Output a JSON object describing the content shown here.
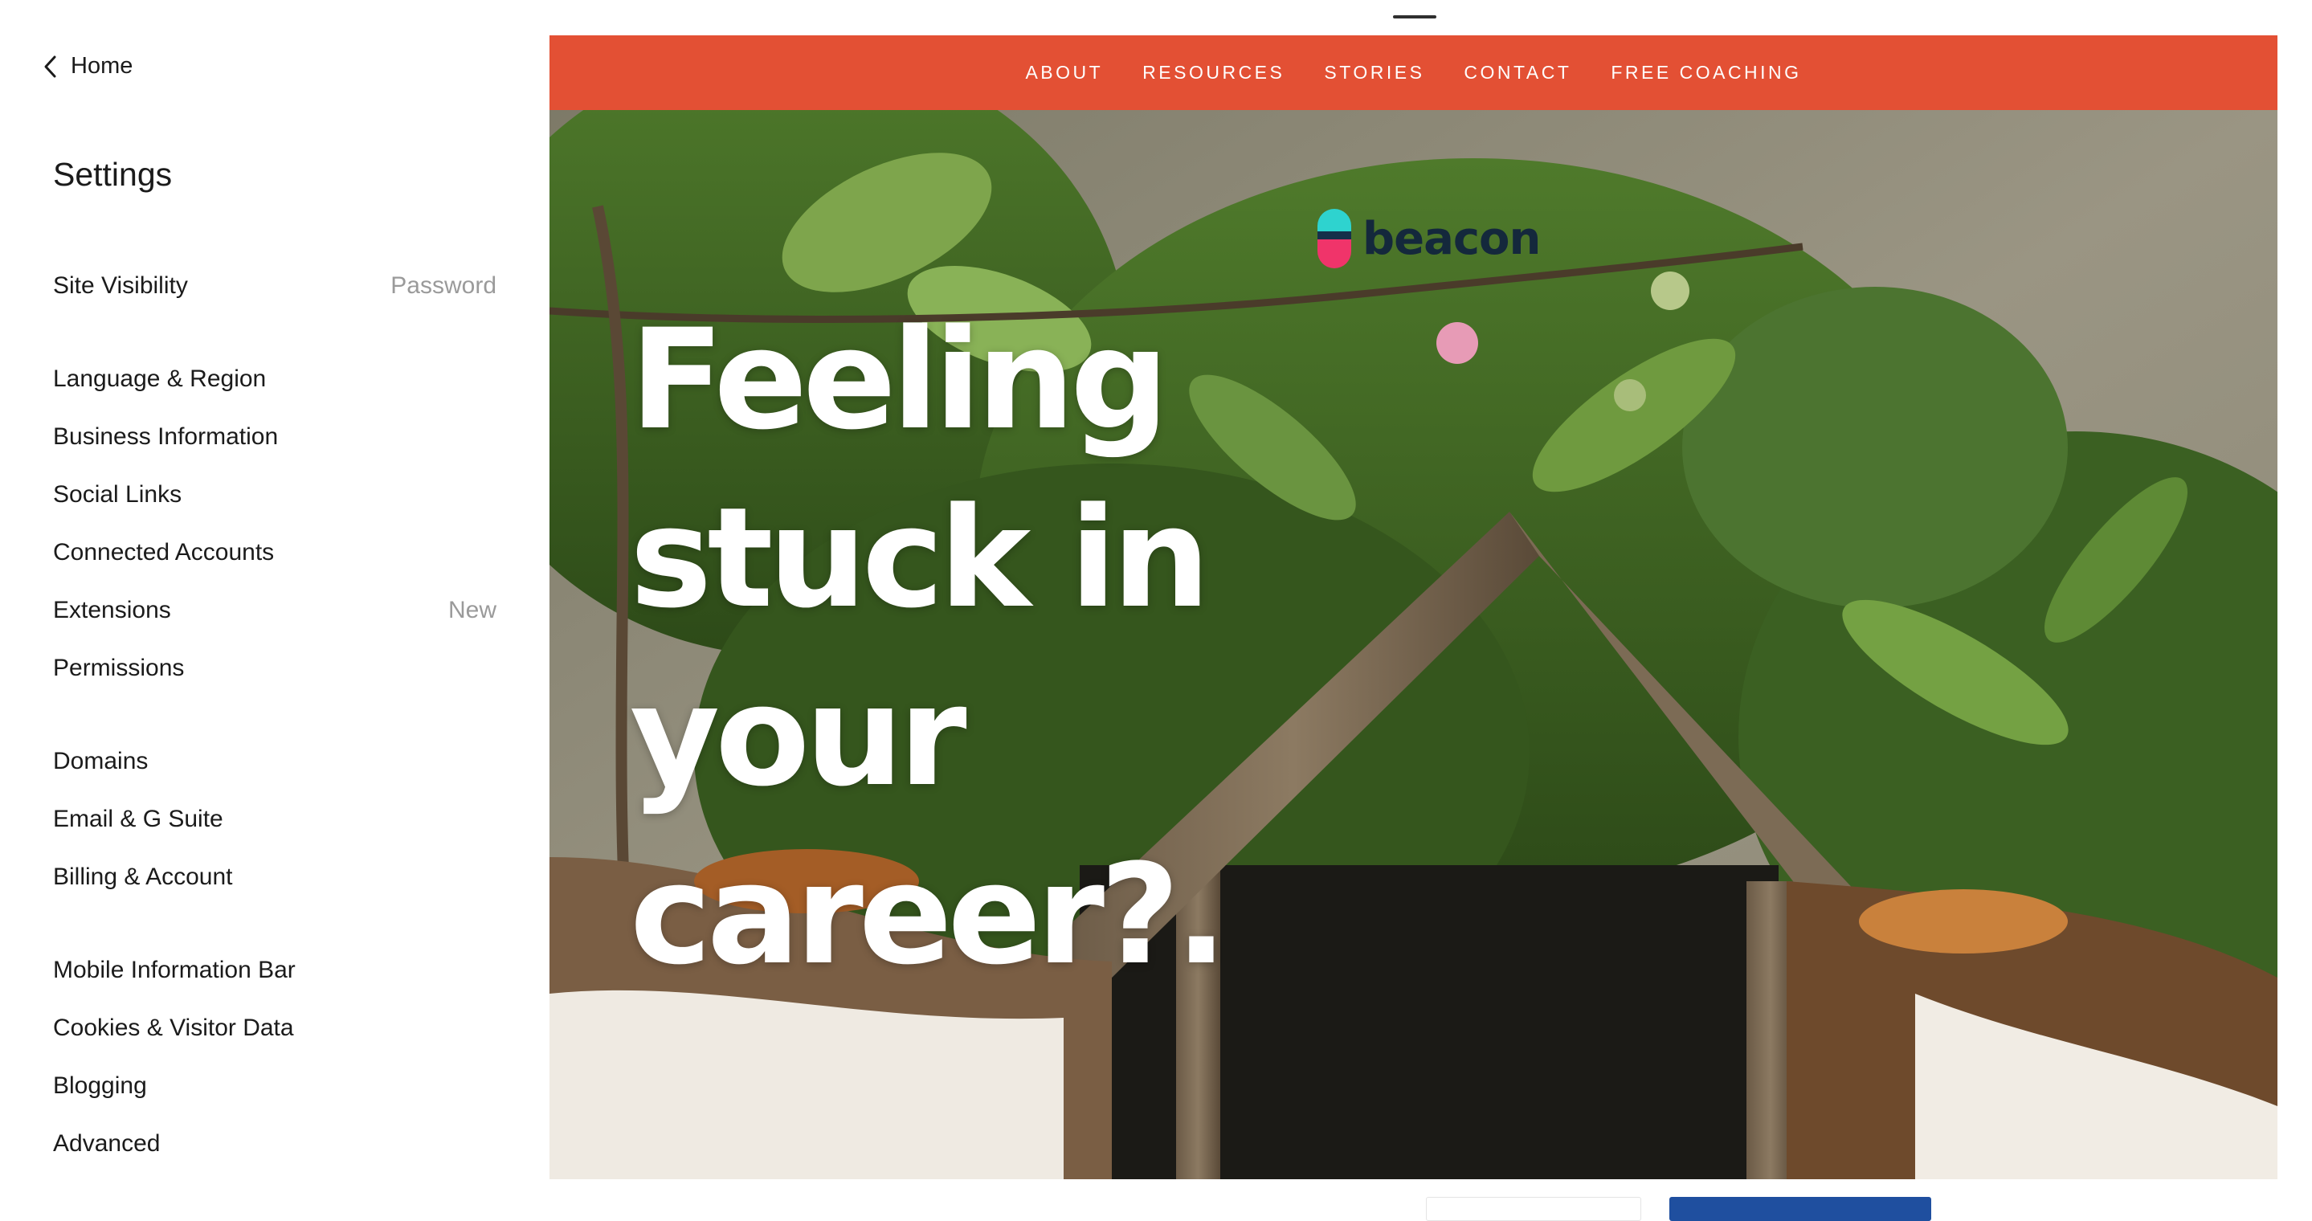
{
  "sidebar": {
    "back_label": "Home",
    "title": "Settings",
    "groups": [
      {
        "items": [
          {
            "label": "Site Visibility",
            "meta": "Password"
          }
        ]
      },
      {
        "items": [
          {
            "label": "Language & Region"
          },
          {
            "label": "Business Information"
          },
          {
            "label": "Social Links"
          },
          {
            "label": "Connected Accounts"
          },
          {
            "label": "Extensions",
            "meta": "New"
          },
          {
            "label": "Permissions"
          }
        ]
      },
      {
        "items": [
          {
            "label": "Domains"
          },
          {
            "label": "Email & G Suite"
          },
          {
            "label": "Billing & Account"
          }
        ]
      },
      {
        "items": [
          {
            "label": "Mobile Information Bar"
          },
          {
            "label": "Cookies & Visitor Data"
          },
          {
            "label": "Blogging"
          },
          {
            "label": "Advanced"
          }
        ]
      }
    ]
  },
  "preview": {
    "nav": [
      "ABOUT",
      "RESOURCES",
      "STORIES",
      "CONTACT",
      "FREE COACHING"
    ],
    "brand": "beacon",
    "headline": [
      "Feeling",
      "stuck in",
      "your",
      "career?."
    ]
  },
  "colors": {
    "nav_bg": "#e35034",
    "brand_teal": "#2ed3cf",
    "brand_pink": "#f0346a",
    "button_blue": "#1f4f9f"
  },
  "icons": {
    "back": "chevron-left-icon",
    "brand_mark": "beacon-logo-icon"
  }
}
